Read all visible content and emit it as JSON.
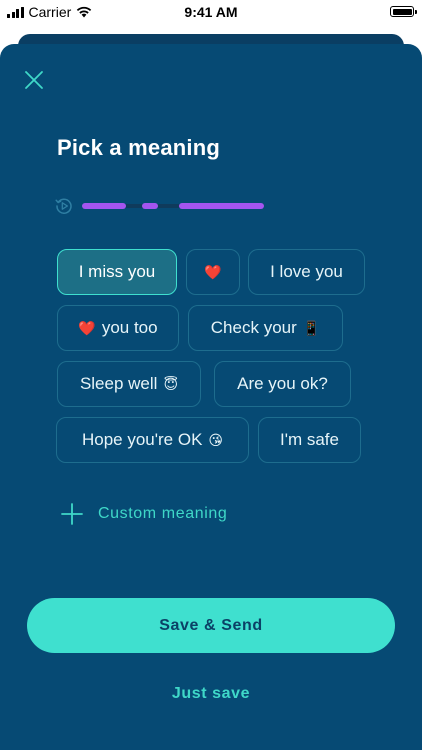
{
  "status_bar": {
    "carrier": "Carrier",
    "time": "9:41 AM"
  },
  "icons": {
    "close": "close-icon",
    "replay": "replay-icon",
    "plus": "plus-icon",
    "wifi": "wifi-icon",
    "battery": "battery-icon",
    "signal": "signal-icon"
  },
  "title": "Pick a meaning",
  "pattern": {
    "segments": [
      "dash",
      "dot",
      "dash"
    ]
  },
  "chips": [
    {
      "label": "I miss you",
      "emoji": "",
      "selected": true
    },
    {
      "label": "",
      "emoji": "❤️",
      "selected": false
    },
    {
      "label": "I love you",
      "emoji": "",
      "selected": false
    },
    {
      "label": "you too",
      "emoji": "❤️",
      "emoji_position": "lead",
      "selected": false
    },
    {
      "label": "Check your",
      "emoji": "📱",
      "selected": false
    },
    {
      "label": "Sleep well",
      "emoji": "😇",
      "selected": false
    },
    {
      "label": "Are you ok?",
      "emoji": "",
      "selected": false
    },
    {
      "label": "Hope you're OK",
      "emoji": "😘",
      "selected": false
    },
    {
      "label": "I'm safe",
      "emoji": "",
      "selected": false
    }
  ],
  "custom_meaning_label": "Custom meaning",
  "save_send_label": "Save & Send",
  "just_save_label": "Just save",
  "colors": {
    "background": "#064a74",
    "accent": "#3fe0cf",
    "pattern": "#a455f0",
    "chip_border": "#1e6d8e",
    "selected_chip_fill": "#1d6f86"
  }
}
